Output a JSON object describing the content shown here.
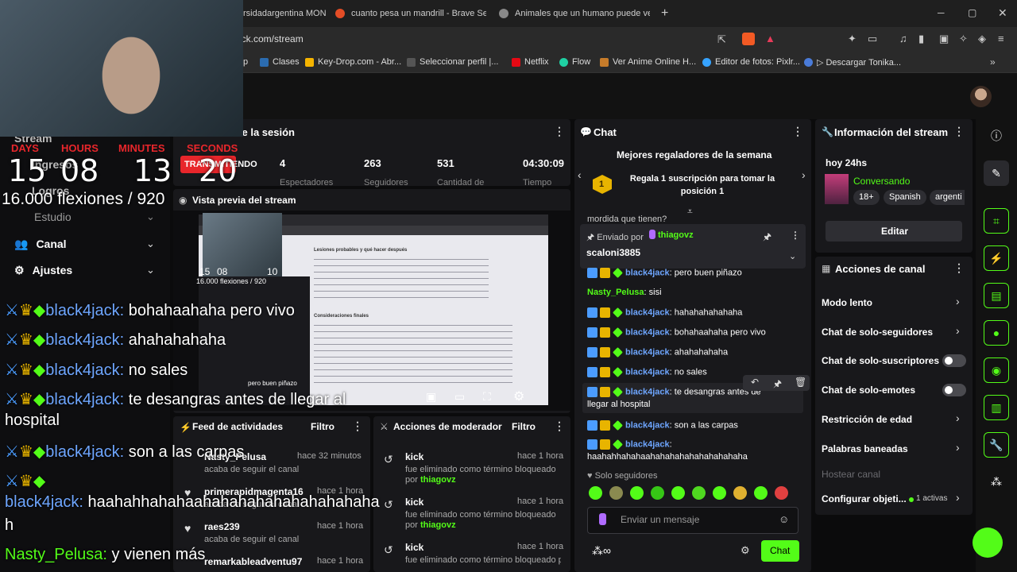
{
  "browser": {
    "tabs": [
      {
        "label": "rsidadargentina MON"
      },
      {
        "label": "cuanto pesa un mandrill - Brave Sear"
      },
      {
        "label": "Animales que un humano puede ven"
      }
    ],
    "new_tab": "+",
    "url": "d.kick.com/stream",
    "bookmarks": [
      "p",
      "Clases",
      "Key-Drop.com - Abr...",
      "Seleccionar perfil |...",
      "Netflix",
      "Flow",
      "Ver Anime Online H...",
      "Editor de fotos: Pixlr...",
      "Descargar Tonika..."
    ]
  },
  "sidebar": {
    "items": [
      {
        "label": "Stream"
      },
      {
        "label": "Ingresos"
      },
      {
        "label": "Logros"
      },
      {
        "label": "Estudio"
      },
      {
        "label": "Canal"
      },
      {
        "label": "Ajustes"
      }
    ]
  },
  "session": {
    "title": "n de la sesión",
    "live_badge": "TRANSMITIENDO",
    "stats": [
      {
        "value": "4",
        "label": "Espectadores"
      },
      {
        "value": "263",
        "label": "Seguidores"
      },
      {
        "value": "531",
        "label": "Cantidad de"
      },
      {
        "value": "04:30:09",
        "label": "Tiempo"
      }
    ]
  },
  "overlay": {
    "countdown_labels": [
      "DAYS",
      "HOURS",
      "MINUTES",
      "SECONDS"
    ],
    "countdown_values": [
      "15",
      "08",
      "13",
      "20"
    ],
    "pushups": "16.000 flexiones / 920",
    "chat": [
      {
        "user": "black4jack:",
        "text": "bohahaahaha pero vivo"
      },
      {
        "user": "black4jack:",
        "text": "ahahahahaha"
      },
      {
        "user": "black4jack:",
        "text": "no sales"
      },
      {
        "user": "black4jack:",
        "text": "te desangras antes de llegar al"
      },
      {
        "user": "",
        "text": "hospital"
      },
      {
        "user": "black4jack:",
        "text": "son a las carpas"
      },
      {
        "user": "black4jack:",
        "text": "haahahhahahaahahahahahahahahahaha"
      },
      {
        "user": "",
        "text": "h"
      },
      {
        "user": "Nasty_Pelusa:",
        "text": "y vienen más"
      }
    ]
  },
  "preview": {
    "title": "Vista previa del stream",
    "mini_count": [
      "15",
      "08",
      "10"
    ],
    "mini_pushups": "16.000 flexiones / 920",
    "doc_heading": "Lesiones probables y qué hacer después",
    "doc_heading2": "Consideraciones finales",
    "chat_snip": "pero buen piñazo"
  },
  "feed": {
    "title": "Feed de actividades",
    "filter": "Filtro",
    "items": [
      {
        "user": "Nasty_Pelusa",
        "action": "acaba de seguir el canal",
        "time": "hace 32 minutos"
      },
      {
        "user": "primerapidmagenta16",
        "action": "acaba de seguir el canal",
        "time": "hace 1 hora"
      },
      {
        "user": "raes239",
        "action": "acaba de seguir el canal",
        "time": "hace 1 hora"
      },
      {
        "user": "remarkableadventu97",
        "action": "",
        "time": "hace 1 hora"
      }
    ]
  },
  "mod": {
    "title": "Acciones de moderador",
    "filter": "Filtro",
    "items": [
      {
        "user": "kick",
        "action": "fue eliminado como término bloqueado por",
        "by": "thiagovz",
        "time": "hace 1 hora"
      },
      {
        "user": "kick",
        "action": "fue eliminado como término bloqueado por",
        "by": "thiagovz",
        "time": "hace 1 hora"
      },
      {
        "user": "kick",
        "action": "fue eliminado como término bloqueado por",
        "by": "",
        "time": "hace 1 hora"
      }
    ]
  },
  "chat": {
    "title": "Chat",
    "gifters_title": "Mejores regaladores de la semana",
    "gift_prompt": "Regala 1 suscripción para tomar la posición 1",
    "gift_rank": "1",
    "partial": "mordida que tienen?",
    "pinned_label": "Enviado por",
    "pinned_by": "thiagovz",
    "pinned_msg": "scaloni3885",
    "messages": [
      {
        "user": "black4jack",
        "text": ": pero buen piñazo"
      },
      {
        "user": "Nasty_Pelusa",
        "text": ": sisi"
      },
      {
        "user": "black4jack",
        "text": ": hahahahahahaha"
      },
      {
        "user": "black4jack",
        "text": ": bohahaahaha pero vivo"
      },
      {
        "user": "black4jack",
        "text": ": ahahahahaha"
      },
      {
        "user": "black4jack",
        "text": ": no sales"
      },
      {
        "user": "black4jack",
        "text": ": te desangras antes de"
      },
      {
        "user": "",
        "text": "llegar al hospital"
      },
      {
        "user": "black4jack",
        "text": ": son a las carpas"
      },
      {
        "user": "black4jack",
        "text": ":"
      },
      {
        "user": "",
        "text": "haahahhahahaahahahahahahahahahaha"
      }
    ],
    "followers_only": "Solo seguidores",
    "input_placeholder": "Enviar un mensaje",
    "send": "Chat"
  },
  "info": {
    "title": "Información del stream",
    "stream_title": "hoy 24hs",
    "category": "Conversando",
    "tags": [
      "18+",
      "Spanish",
      "argenti"
    ],
    "edit": "Editar"
  },
  "actions": {
    "title": "Acciones de canal",
    "rows": [
      {
        "label": "Modo lento",
        "kind": "chevron"
      },
      {
        "label": "Chat de solo-seguidores",
        "kind": "chevron"
      },
      {
        "label": "Chat de solo-suscriptores",
        "kind": "toggle"
      },
      {
        "label": "Chat de solo-emotes",
        "kind": "toggle"
      },
      {
        "label": "Restricción de edad",
        "kind": "chevron"
      },
      {
        "label": "Palabras baneadas",
        "kind": "chevron"
      },
      {
        "label": "Hostear canal",
        "kind": "disabled"
      },
      {
        "label": "Configurar objeti...",
        "kind": "chevron",
        "extra": "1 activas"
      }
    ]
  },
  "colors": {
    "accent": "#53fc18",
    "panel": "#18181b",
    "live": "#e8262b",
    "link": "#6ea6ff"
  }
}
